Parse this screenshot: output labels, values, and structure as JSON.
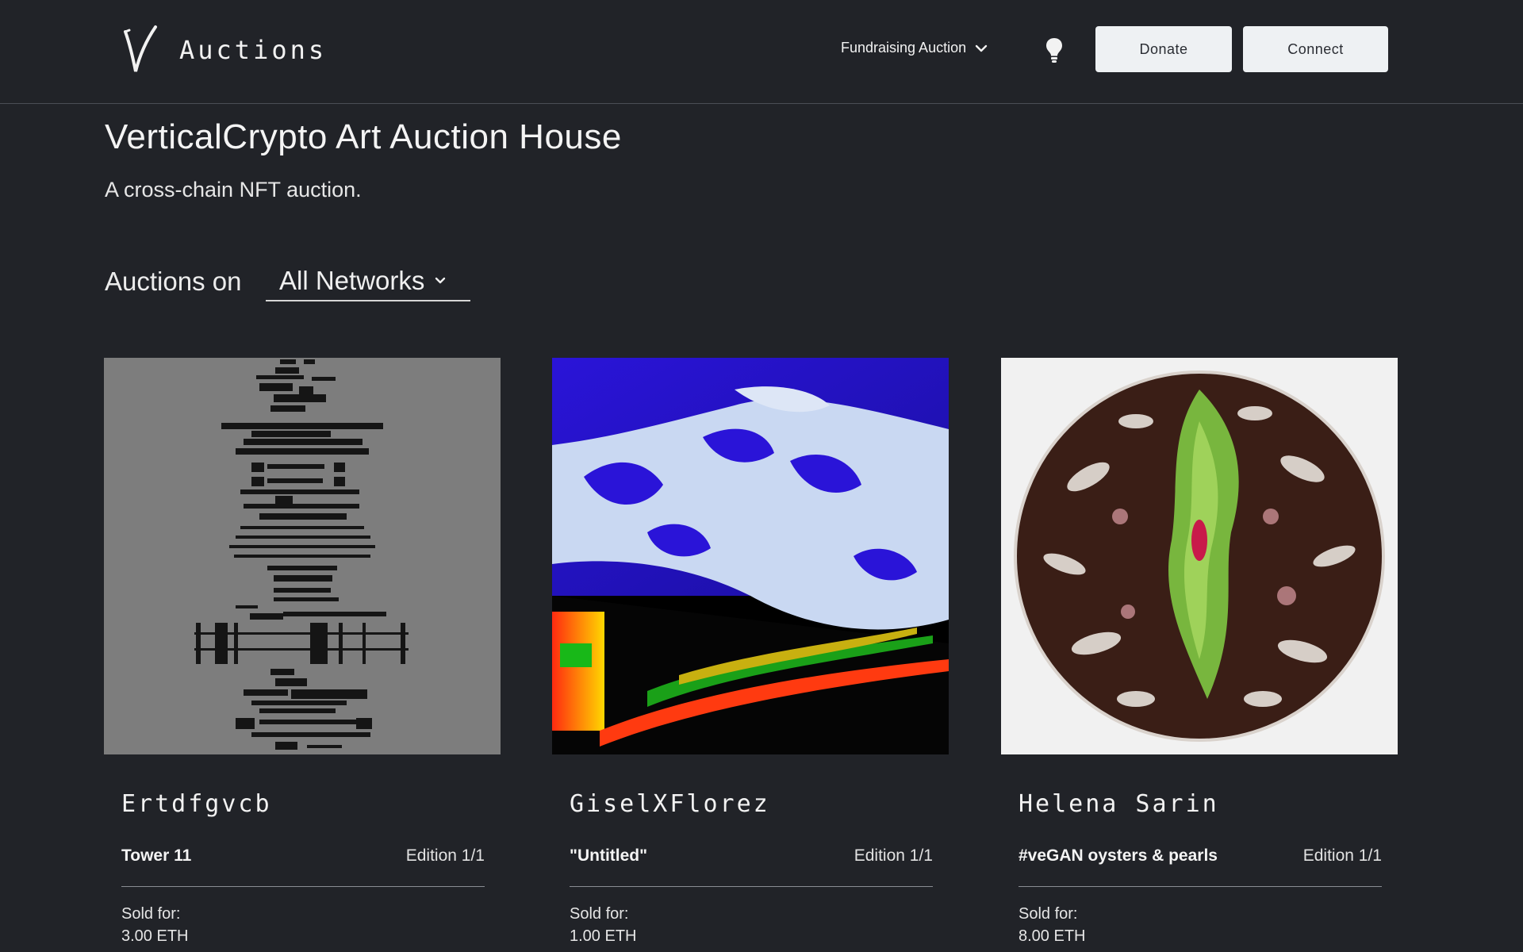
{
  "header": {
    "brand": "Auctions",
    "nav_dropdown_label": "Fundraising Auction",
    "donate_label": "Donate",
    "connect_label": "Connect"
  },
  "hero": {
    "title": "VerticalCrypto Art Auction House",
    "subtitle": "A cross-chain NFT auction."
  },
  "filter": {
    "label": "Auctions on",
    "selected_network": "All Networks"
  },
  "cards": [
    {
      "artist": "Ertdfgvcb",
      "title": "Tower 11",
      "edition": "Edition 1/1",
      "sold_label": "Sold for:",
      "sold_value": "3.00 ETH"
    },
    {
      "artist": "GiselXFlorez",
      "title": "\"Untitled\"",
      "edition": "Edition 1/1",
      "sold_label": "Sold for:",
      "sold_value": "1.00 ETH"
    },
    {
      "artist": "Helena Sarin",
      "title": "#veGAN oysters & pearls",
      "edition": "Edition 1/1",
      "sold_label": "Sold for:",
      "sold_value": "8.00 ETH"
    }
  ],
  "colors": {
    "background": "#212328",
    "button_bg": "#eef1f3",
    "text": "#ffffff"
  },
  "icons": {
    "logo": "v-logo-icon",
    "dropdown": "chevron-down-icon",
    "theme_toggle": "lightbulb-icon"
  }
}
